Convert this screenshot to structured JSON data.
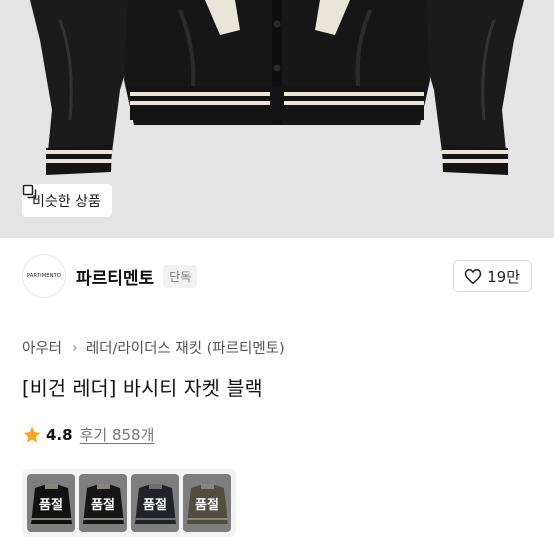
{
  "hero": {
    "similar_button_label": "비슷한 상품",
    "similar_icon": "overlapping-squares-icon"
  },
  "brand": {
    "logo_text": "PARTIMENTO",
    "name": "파르티멘토",
    "tag": "단독",
    "like_icon": "heart-outline-icon",
    "like_count": "19만"
  },
  "breadcrumb": {
    "category": "아우터",
    "subcategory": "레더/라이더스 재킷 (파르티멘토)"
  },
  "product": {
    "title": "[비건 레더] 바시티 자켓 블랙"
  },
  "rating": {
    "star_icon": "star-icon",
    "score": "4.8",
    "reviews": "후기 858개",
    "star_color": "#f5a623"
  },
  "options": [
    {
      "label": "품절",
      "color": "#1e1e1e"
    },
    {
      "label": "품절",
      "color": "#252525"
    },
    {
      "label": "품절",
      "color": "#3a3d44"
    },
    {
      "label": "품절",
      "color": "#8c8670"
    }
  ]
}
